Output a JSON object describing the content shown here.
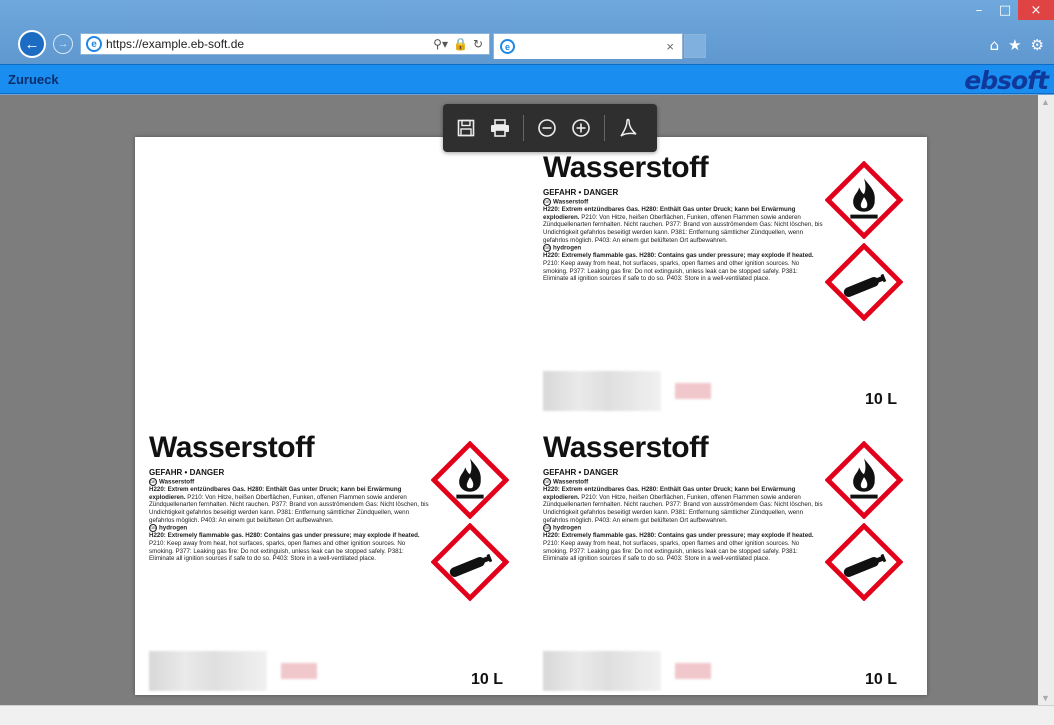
{
  "browser": {
    "url": "https://example.eb-soft.de",
    "tab_title": "",
    "window_controls": {
      "minimize": "–",
      "maximize": "□",
      "close": "×"
    },
    "icons": [
      "back-arrow-icon",
      "forward-arrow-icon",
      "search-icon",
      "lock-icon",
      "refresh-icon",
      "home-icon",
      "star-icon",
      "gear-icon"
    ]
  },
  "app": {
    "back_link": "Zurueck",
    "logo": "ebsoft",
    "accent_color": "#1a8df0"
  },
  "pdf_toolbar": {
    "icons": [
      "save-icon",
      "print-icon",
      "zoom-out-icon",
      "zoom-in-icon",
      "acrobat-icon"
    ]
  },
  "labels": {
    "name": "Wasserstoff",
    "signal": "GEFAHR • DANGER",
    "de_lang_code": "DE",
    "de_lang": "Wasserstoff",
    "de_bold": "H220: Extrem entzündbares Gas. H280: Enthält Gas unter Druck; kann bei Erwärmung explodieren.",
    "de_text": "P210: Von Hitze, heißen Oberflächen, Funken, offenen Flammen sowie anderen Zündquellenarten fernhalten. Nicht rauchen. P377: Brand von ausströmendem Gas: Nicht löschen, bis Undichtigkeit gefahrlos beseitigt werden kann. P381: Entfernung sämtlicher Zündquellen, wenn gefahrlos möglich. P403: An einem gut belüfteten Ort aufbewahren.",
    "en_lang_code": "GB",
    "en_lang": "hydrogen",
    "en_bold": "H220: Extremely flammable gas. H280: Contains gas under pressure; may explode if heated.",
    "en_text": "P210: Keep away from heat, hot surfaces, sparks, open flames and other ignition sources. No smoking. P377: Leaking gas fire: Do not extinguish, unless leak can be stopped safely. P381: Eliminate all ignition sources if safe to do so. P403: Store in a well-ventilated place.",
    "volume": "10 L",
    "pictograms": [
      "flame-pictogram-icon",
      "gas-cylinder-pictogram-icon"
    ],
    "pictogram_border_color": "#e2001a"
  }
}
